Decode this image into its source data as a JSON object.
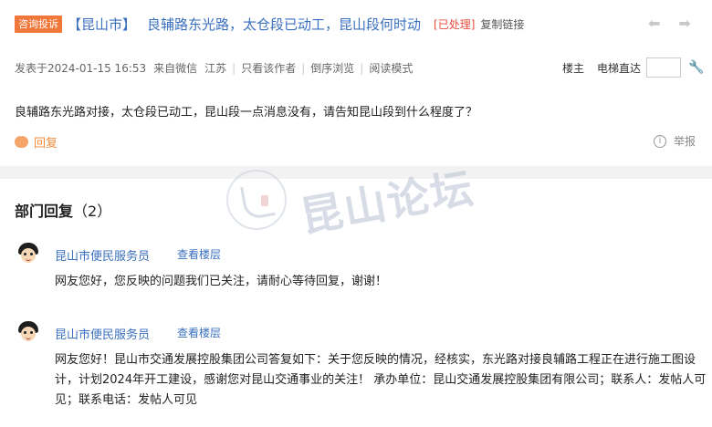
{
  "topic": {
    "badge": "咨询投诉",
    "tag": "【昆山市】",
    "title": "良辅路东光路，太仓段已动工，昆山段何时动",
    "status": "[已处理]",
    "copy_link": "复制链接"
  },
  "meta": {
    "posted": "发表于2024-01-15 16:53",
    "source": "来自微信",
    "region": "江苏",
    "only_author": "只看该作者",
    "reverse": "倒序浏览",
    "read_mode": "阅读模式",
    "owner": "楼主",
    "elevator": "电梯直达"
  },
  "content": "良辅路东光路对接，太仓段已动工，昆山段一点消息没有，请告知昆山段到什么程度了？",
  "actions": {
    "reply": "回复",
    "report": "举报"
  },
  "section": {
    "title": "部门回复",
    "count": "（2）"
  },
  "watermark": {
    "text": "昆山论坛"
  },
  "replies": [
    {
      "name": "昆山市便民服务员",
      "floor": "查看楼层",
      "body": "网友您好，您反映的问题我们已关注，请耐心等待回复，谢谢！"
    },
    {
      "name": "昆山市便民服务员",
      "floor": "查看楼层",
      "body": "网友您好！昆山市交通发展控股集团公司答复如下：关于您反映的情况，经核实，东光路对接良辅路工程正在进行施工图设计，计划2024年开工建设，感谢您对昆山交通事业的关注！ 承办单位：昆山交通发展控股集团有限公司；联系人：发帖人可见；联系电话：发帖人可见"
    }
  ]
}
